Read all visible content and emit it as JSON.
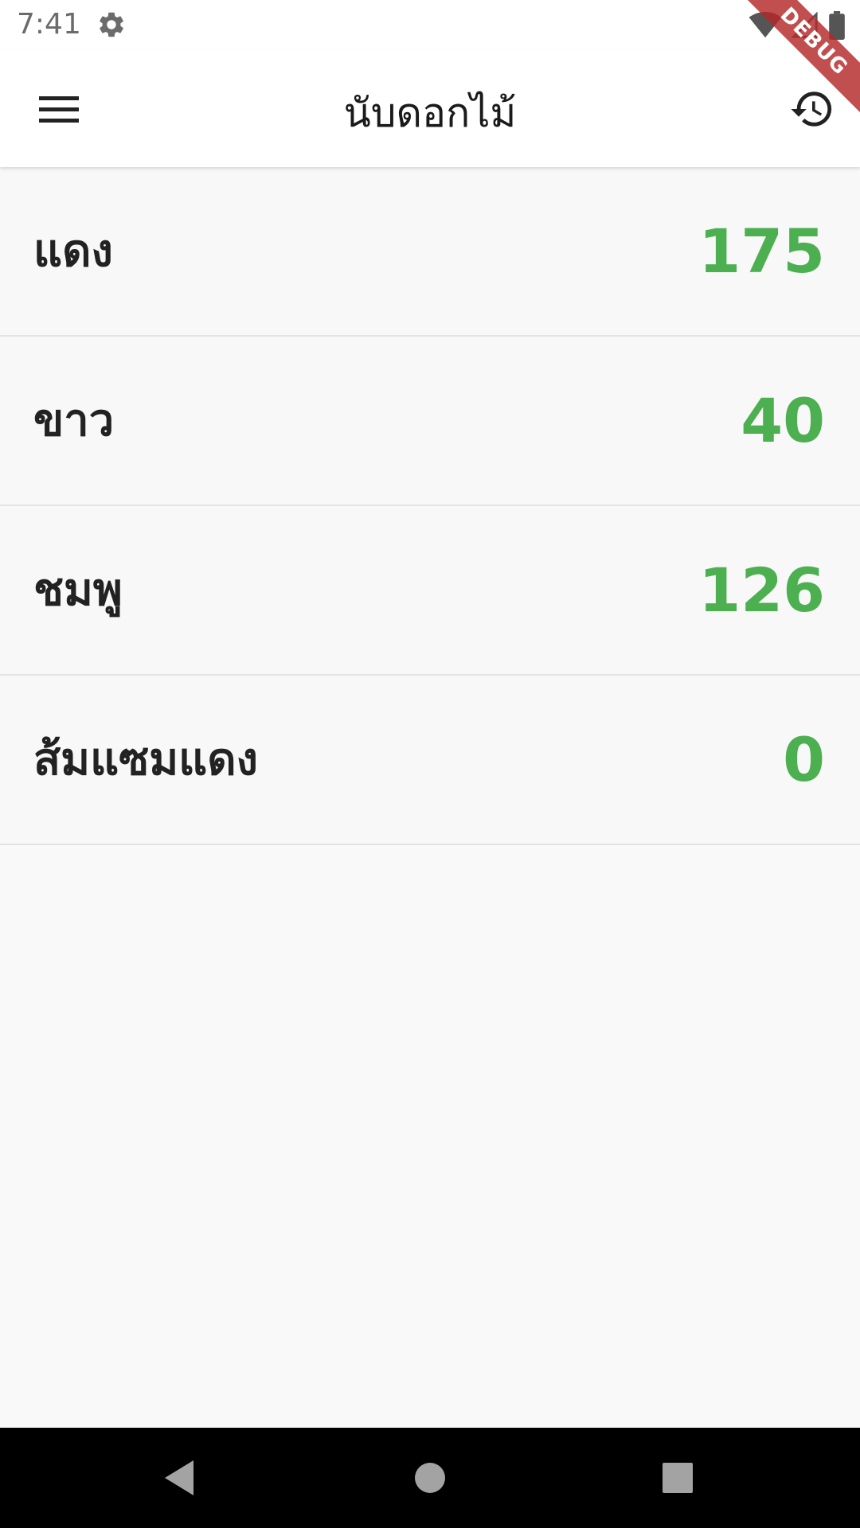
{
  "status_bar": {
    "time": "7:41",
    "icons": [
      "gear-icon",
      "wifi-icon",
      "signal-icon",
      "battery-icon"
    ]
  },
  "debug_banner": "DEBUG",
  "app_bar": {
    "title": "นับดอกไม้",
    "menu_icon": "menu-icon",
    "history_icon": "history-icon"
  },
  "flowers": [
    {
      "name": "แดง",
      "count": "175"
    },
    {
      "name": "ขาว",
      "count": "40"
    },
    {
      "name": "ชมพู",
      "count": "126"
    },
    {
      "name": "ส้มแซมแดง",
      "count": "0"
    }
  ],
  "nav_bar": {
    "icons": [
      "back-icon",
      "home-icon",
      "recents-icon"
    ]
  },
  "colors": {
    "count": "#4caf50",
    "debug_banner": "#b42828",
    "nav_bar": "#000000"
  }
}
